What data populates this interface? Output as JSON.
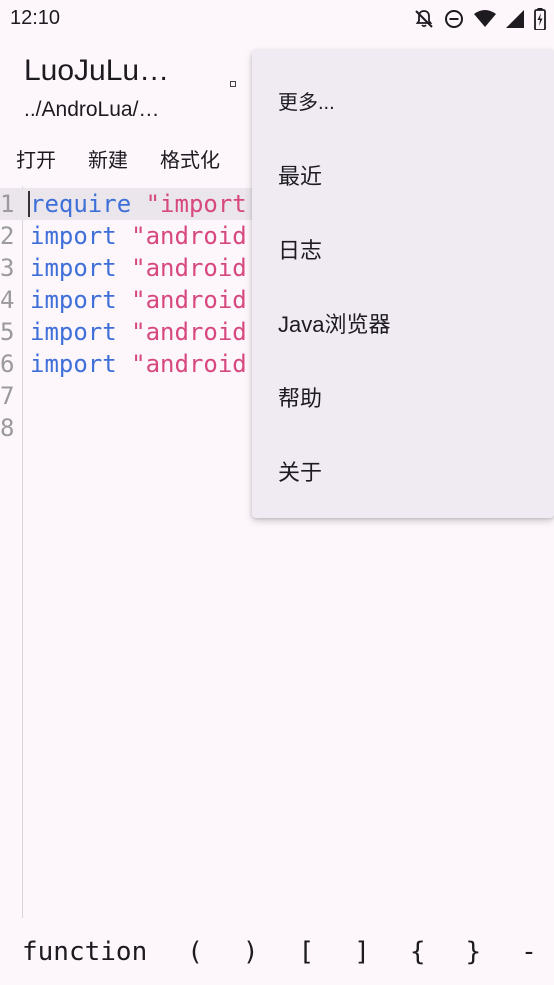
{
  "status_bar": {
    "time": "12:10",
    "icons": [
      "notifications-off-icon",
      "do-not-disturb-icon",
      "wifi-icon",
      "signal-icon",
      "battery-charging-icon"
    ]
  },
  "app_bar": {
    "title": "LuoJuLu…",
    "subtitle": "../AndroLua/…"
  },
  "toolbar": {
    "open_label": "打开",
    "new_label": "新建",
    "format_label": "格式化"
  },
  "editor": {
    "lines": [
      {
        "num": "1",
        "keyword": "require",
        "string": " \"import"
      },
      {
        "num": "2",
        "keyword": "import",
        "string": " \"android"
      },
      {
        "num": "3",
        "keyword": "import",
        "string": " \"android"
      },
      {
        "num": "4",
        "keyword": "import",
        "string": " \"android"
      },
      {
        "num": "5",
        "keyword": "import",
        "string": " \"android"
      },
      {
        "num": "6",
        "keyword": "import",
        "string": " \"android"
      },
      {
        "num": "7",
        "keyword": "",
        "string": ""
      },
      {
        "num": "8",
        "keyword": "",
        "string": ""
      }
    ]
  },
  "symbol_bar": {
    "items": [
      "function",
      "(",
      ")",
      "[",
      "]",
      "{",
      "}",
      "-"
    ]
  },
  "overflow_menu": {
    "items": [
      "更多...",
      "最近",
      "日志",
      "Java浏览器",
      "帮助",
      "关于"
    ]
  },
  "colors": {
    "keyword": "#3f6fd8",
    "string": "#d7487f",
    "background": "#fdf7fc",
    "menu_background": "#f0ebf3"
  }
}
